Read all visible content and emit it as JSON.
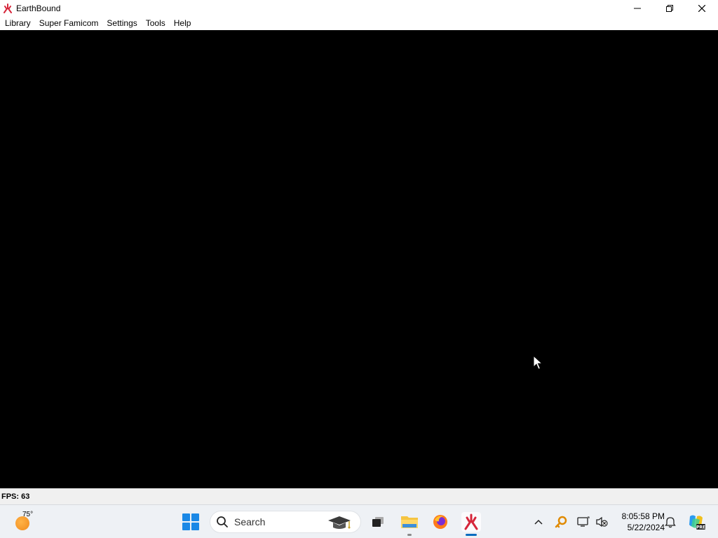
{
  "window": {
    "title": "EarthBound",
    "icon": "higan-fire-icon",
    "controls": [
      "minimize-icon",
      "restore-icon",
      "close-icon"
    ]
  },
  "menu": {
    "items": [
      "Library",
      "Super Famicom",
      "Settings",
      "Tools",
      "Help"
    ]
  },
  "status": {
    "fps_text": "FPS: 63"
  },
  "taskbar": {
    "weather_temp": "75°",
    "search_placeholder": "Search",
    "clock_time": "8:05:58 PM",
    "clock_date": "5/22/2024",
    "pinned": [
      "windows-start-icon",
      "search-icon",
      "task-view-icon",
      "file-explorer-icon",
      "firefox-icon",
      "higan-taskbar-icon"
    ],
    "tray": [
      "show-hidden-icons-chevron",
      "key-app-icon",
      "network-icon",
      "volume-muted-icon",
      "notification-bell-icon",
      "copilot-icon"
    ]
  },
  "colors": {
    "viewport_bg": "#000000",
    "accent": "#1a88e6",
    "app_icon_red": "#d6263b"
  }
}
